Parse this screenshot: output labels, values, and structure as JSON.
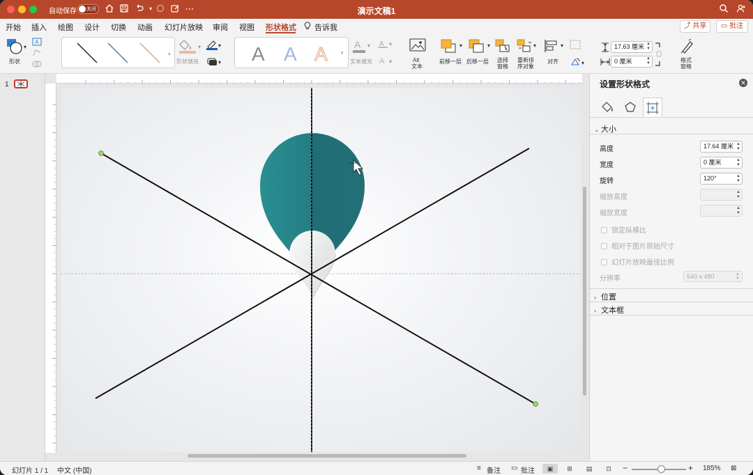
{
  "titlebar": {
    "autosave_label": "自动保存",
    "autosave_state": "关闭",
    "doc_title": "演示文稿1",
    "icons": [
      "home-icon",
      "save-icon",
      "undo-icon",
      "redo-icon",
      "edit-icon",
      "more-icon",
      "search-icon",
      "share-icon"
    ]
  },
  "menubar": {
    "tabs": [
      "开始",
      "插入",
      "绘图",
      "设计",
      "切换",
      "动画",
      "幻灯片放映",
      "审阅",
      "视图",
      "形状格式"
    ],
    "active_tab": "形状格式",
    "tell_me": "告诉我",
    "share": "共享",
    "comments": "批注"
  },
  "ribbon": {
    "shape_label": "形状",
    "shape_fill": "形状填充",
    "text_fill": "文本填充",
    "alt_text_1": "Alt",
    "alt_text_2": "文本",
    "bring_forward": "前移一层",
    "send_backward": "后移一层",
    "selection_pane_1": "选择",
    "selection_pane_2": "窗格",
    "reorder_1": "重新排",
    "reorder_2": "序对象",
    "align": "对齐",
    "height_value": "17.63 厘米",
    "width_value": "0 厘米",
    "format_pane_1": "格式",
    "format_pane_2": "窗格",
    "wordart_letter": "A"
  },
  "thumbnails": {
    "slide_number": "1"
  },
  "pane": {
    "title": "设置形状格式",
    "section_size": "大小",
    "height_label": "高度",
    "height_value": "17.64 厘米",
    "width_label": "宽度",
    "width_value": "0 厘米",
    "rotation_label": "旋转",
    "rotation_value": "120°",
    "scale_height_label": "缩放高度",
    "scale_width_label": "缩放宽度",
    "lock_aspect": "锁定纵横比",
    "relative_original": "相对于图片原始尺寸",
    "best_scale": "幻灯片放映最佳比例",
    "resolution_label": "分辨率",
    "resolution_value": "640 x 480",
    "section_position": "位置",
    "section_textbox": "文本框"
  },
  "statusbar": {
    "slide_info": "幻灯片 1 / 1",
    "language": "中文 (中国)",
    "notes": "备注",
    "comments": "批注",
    "zoom_pct": "185%",
    "zoom_level": 0.54
  },
  "colors": {
    "accent": "#b7472a",
    "teal_pin": "#257d82",
    "line": "#111111"
  }
}
